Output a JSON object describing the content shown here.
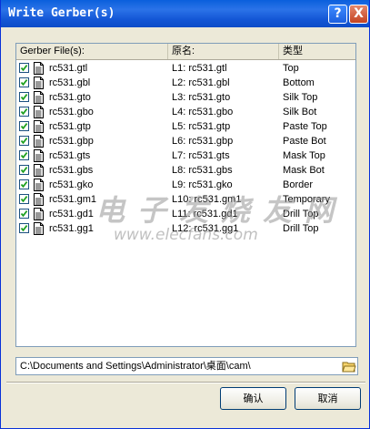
{
  "window": {
    "title": "Write Gerber(s)",
    "help_label": "?",
    "close_label": "X"
  },
  "list": {
    "headers": [
      "Gerber File(s):",
      "原名:",
      "类型"
    ],
    "rows": [
      {
        "checked": true,
        "name": "rc531.gtl",
        "layer": "L1: rc531.gtl",
        "type": "Top"
      },
      {
        "checked": true,
        "name": "rc531.gbl",
        "layer": "L2: rc531.gbl",
        "type": "Bottom"
      },
      {
        "checked": true,
        "name": "rc531.gto",
        "layer": "L3: rc531.gto",
        "type": "Silk Top"
      },
      {
        "checked": true,
        "name": "rc531.gbo",
        "layer": "L4: rc531.gbo",
        "type": "Silk Bot"
      },
      {
        "checked": true,
        "name": "rc531.gtp",
        "layer": "L5: rc531.gtp",
        "type": "Paste Top"
      },
      {
        "checked": true,
        "name": "rc531.gbp",
        "layer": "L6: rc531.gbp",
        "type": "Paste Bot"
      },
      {
        "checked": true,
        "name": "rc531.gts",
        "layer": "L7: rc531.gts",
        "type": "Mask Top"
      },
      {
        "checked": true,
        "name": "rc531.gbs",
        "layer": "L8: rc531.gbs",
        "type": "Mask Bot"
      },
      {
        "checked": true,
        "name": "rc531.gko",
        "layer": "L9: rc531.gko",
        "type": "Border"
      },
      {
        "checked": true,
        "name": "rc531.gm1",
        "layer": "L10: rc531.gm1",
        "type": "Temporary"
      },
      {
        "checked": true,
        "name": "rc531.gd1",
        "layer": "L11: rc531.gd1",
        "type": "Drill Top"
      },
      {
        "checked": true,
        "name": "rc531.gg1",
        "layer": "L12: rc531.gg1",
        "type": "Drill Top"
      }
    ]
  },
  "output_path": "C:\\Documents and Settings\\Administrator\\桌面\\cam\\",
  "buttons": {
    "ok_label": "确认",
    "cancel_label": "取消"
  },
  "watermark": {
    "text": "电子发烧友网",
    "url": "www.elecfans.com"
  },
  "colors": {
    "titlebar": "#0a5fdc",
    "dialog_bg": "#ece9d8",
    "checkbox_border": "#1c5180",
    "checkmark": "#21a121"
  },
  "icons": {
    "row_icon": "document-icon",
    "browse_icon": "folder-open-icon"
  }
}
